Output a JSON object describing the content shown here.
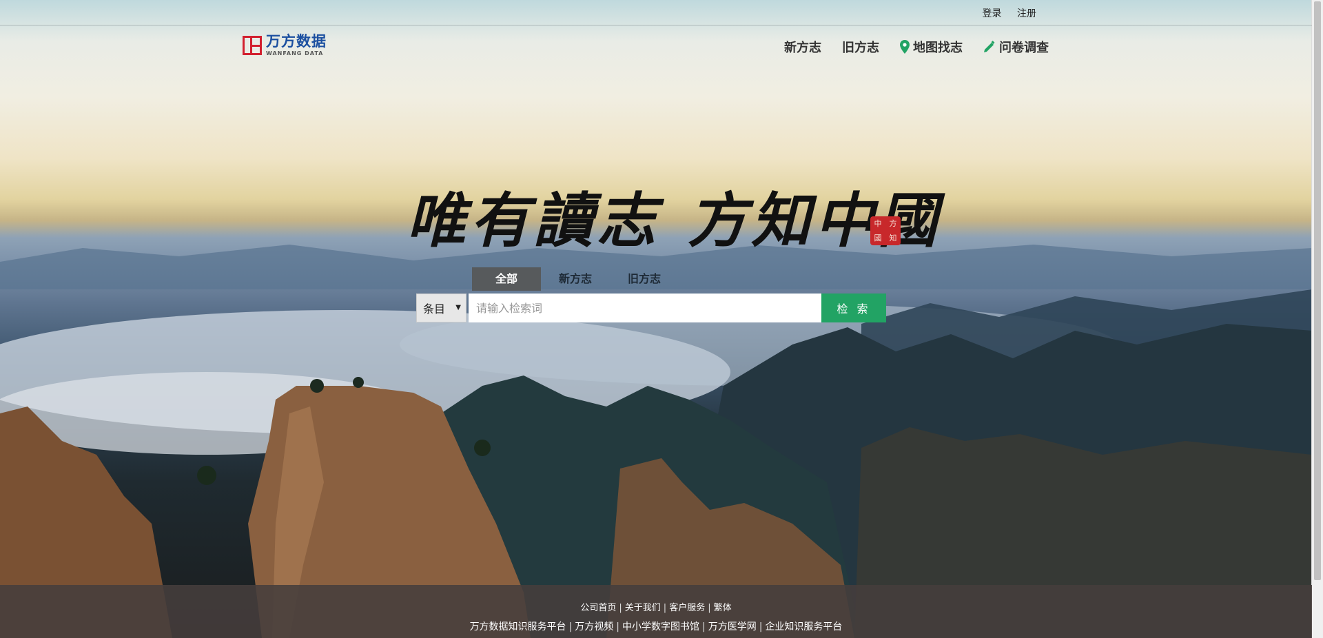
{
  "topbar": {
    "login": "登录",
    "register": "注册"
  },
  "logo": {
    "cn": "万方数据",
    "en": "WANFANG DATA"
  },
  "nav": [
    {
      "label": "新方志",
      "icon": ""
    },
    {
      "label": "旧方志",
      "icon": ""
    },
    {
      "label": "地图找志",
      "icon": "map-pin-icon"
    },
    {
      "label": "问卷调查",
      "icon": "pencil-icon"
    }
  ],
  "slogan": {
    "part1": "唯有讀志",
    "part2": "方知中國"
  },
  "seal": {
    "chars": [
      "中",
      "方",
      "國",
      "知"
    ]
  },
  "search": {
    "tabs": [
      "全部",
      "新方志",
      "旧方志"
    ],
    "active_tab": "全部",
    "select_value": "条目",
    "placeholder": "请输入检索词",
    "button": "检 索"
  },
  "footer": {
    "row1": [
      "公司首页",
      "关于我们",
      "客户服务",
      "繁体"
    ],
    "row2": [
      "万方数据知识服务平台",
      "万方视频",
      "中小学数字图书馆",
      "万方医学网",
      "企业知识服务平台"
    ]
  },
  "colors": {
    "accent_green": "#22a364",
    "logo_red": "#d2202f",
    "logo_blue": "#1b4fa0"
  }
}
